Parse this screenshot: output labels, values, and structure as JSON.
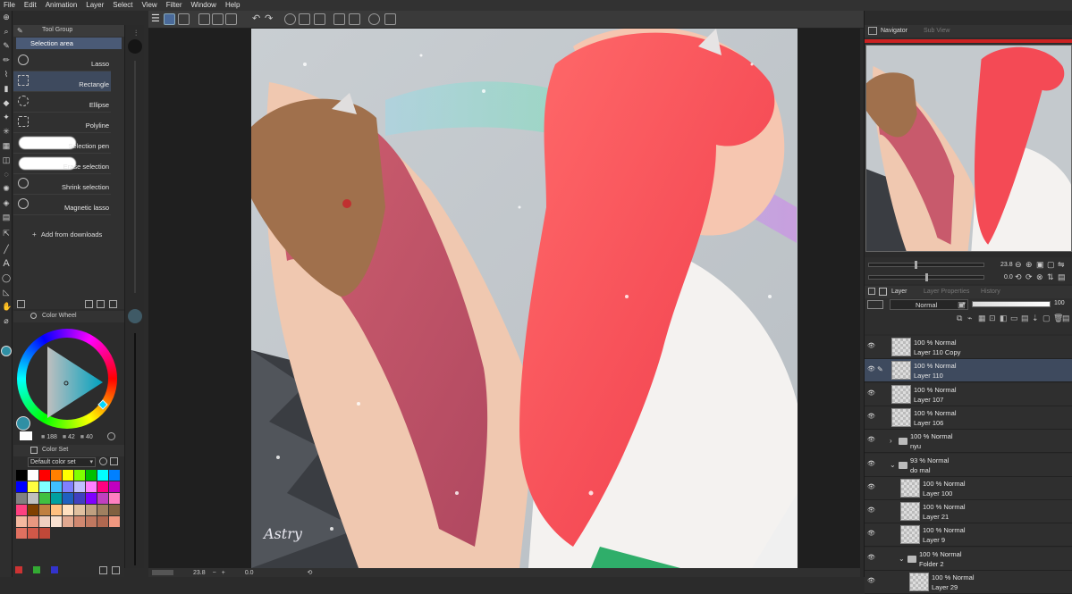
{
  "menu": [
    "File",
    "Edit",
    "Animation",
    "Layer",
    "Select",
    "View",
    "Filter",
    "Window",
    "Help"
  ],
  "subtool": {
    "group_label": "Tool Group",
    "current": "Selection area",
    "items": [
      "Lasso",
      "Rectangle",
      "Ellipse",
      "Polyline",
      "Selection pen",
      "Erase selection",
      "Shrink selection",
      "Magnetic lasso"
    ],
    "add_label": "Add from downloads"
  },
  "color_wheel": {
    "title": "Color Wheel",
    "values": [
      "188",
      "42",
      "40"
    ],
    "current_color": "#2f8fa4"
  },
  "color_set": {
    "title": "Color Set",
    "selected": "Default color set",
    "swatches": [
      "#000000",
      "#ffffff",
      "#ff0000",
      "#ff8000",
      "#ffff00",
      "#80ff00",
      "#00c000",
      "#00ffff",
      "#0080ff",
      "#0000ff",
      "#ffff40",
      "#80ffff",
      "#40c0ff",
      "#8080ff",
      "#c0c0ff",
      "#ff80ff",
      "#ff0080",
      "#c000c0",
      "#808080",
      "#c0c0c0",
      "#40c040",
      "#00a0a0",
      "#2060c0",
      "#4040c0",
      "#8000ff",
      "#c040c0",
      "#ff80c0",
      "#ff4080",
      "#804000",
      "#c08040",
      "#ffc080",
      "#ffe0c0",
      "#e0c0a0",
      "#c0a080",
      "#a08060",
      "#806040",
      "#f4b8a0",
      "#e89880",
      "#f0d0c0",
      "#f8e0d0",
      "#e0a890",
      "#d08870",
      "#c07860",
      "#b06850",
      "#f09880",
      "#e07060",
      "#d05848",
      "#c04838"
    ]
  },
  "statusbar": {
    "zoom": "23.8",
    "coord": "0.0"
  },
  "navigator": {
    "tab": "Navigator",
    "tab2": "Sub View",
    "zoom": "23.8",
    "angle": "0.0"
  },
  "layers": {
    "tab": "Layer",
    "tab2": "Layer Properties",
    "tab3": "History",
    "blend": "Normal",
    "opacity": "100",
    "rows": [
      {
        "mode": "100 % Normal",
        "name": "Layer 110 Copy",
        "indent": 0,
        "type": "layer",
        "selected": false
      },
      {
        "mode": "100 % Normal",
        "name": "Layer 110",
        "indent": 0,
        "type": "layer",
        "selected": true
      },
      {
        "mode": "100 % Normal",
        "name": "Layer 107",
        "indent": 0,
        "type": "layer",
        "selected": false
      },
      {
        "mode": "100 % Normal",
        "name": "Layer 106",
        "indent": 0,
        "type": "layer",
        "selected": false
      },
      {
        "mode": "100 % Normal",
        "name": "nyu",
        "indent": 0,
        "type": "folder-closed",
        "selected": false
      },
      {
        "mode": "93 % Normal",
        "name": "do mal",
        "indent": 0,
        "type": "folder-open",
        "selected": false
      },
      {
        "mode": "100 % Normal",
        "name": "Layer 100",
        "indent": 1,
        "type": "layer",
        "selected": false
      },
      {
        "mode": "100 % Normal",
        "name": "Layer 21",
        "indent": 1,
        "type": "layer",
        "selected": false
      },
      {
        "mode": "100 % Normal",
        "name": "Layer 9",
        "indent": 1,
        "type": "layer",
        "selected": false
      },
      {
        "mode": "100 % Normal",
        "name": "Folder 2",
        "indent": 1,
        "type": "folder-open",
        "selected": false
      },
      {
        "mode": "100 % Normal",
        "name": "Layer 29",
        "indent": 2,
        "type": "layer",
        "selected": false
      }
    ]
  },
  "artwork": {
    "signature": "Astry"
  }
}
